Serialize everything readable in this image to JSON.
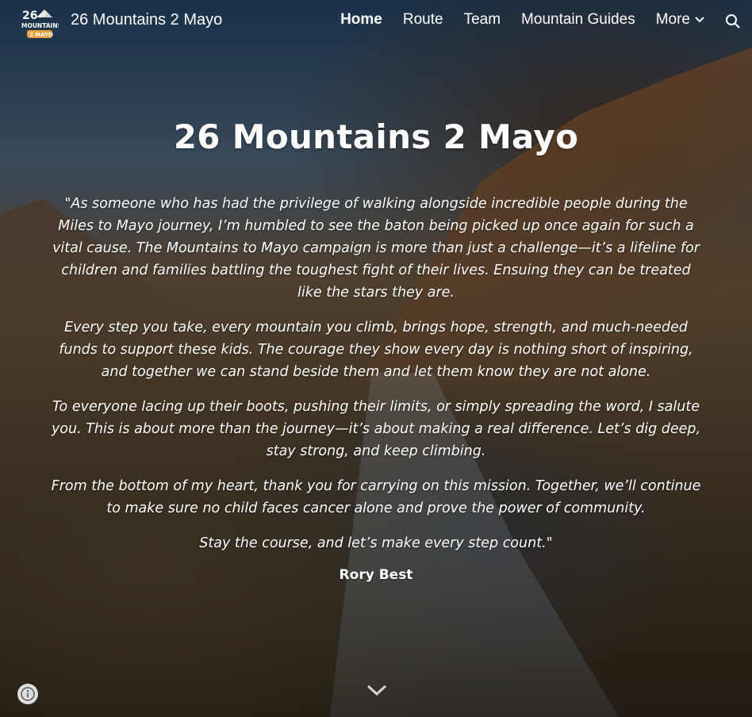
{
  "header": {
    "site_title": "26 Mountains 2 Mayo",
    "logo_text_top": "26",
    "logo_text_mid": "MOUNTAINS",
    "logo_text_bottom": "2 MAYO",
    "nav": [
      {
        "label": "Home",
        "active": true
      },
      {
        "label": "Route",
        "active": false
      },
      {
        "label": "Team",
        "active": false
      },
      {
        "label": "Mountain Guides",
        "active": false
      },
      {
        "label": "More",
        "active": false
      }
    ],
    "search_icon": "search-icon",
    "more_icon": "chevron-down-icon"
  },
  "main": {
    "title": "26 Mountains 2 Mayo",
    "quote_paragraphs": [
      "\"As someone who has had the privilege of walking alongside incredible people during the Miles to Mayo journey, I’m humbled to see the baton being picked up once again for such a vital cause. The Mountains to Mayo campaign is more than just a challenge—it’s a lifeline for children and families battling the toughest fight of their lives. Ensuing they can be treated like the stars they are.",
      "Every step you take, every mountain you climb, brings hope, strength, and much-needed funds to support these kids. The courage they show every day is nothing short of inspiring, and together we can stand beside them and let them know they are not alone.",
      "To everyone lacing up their boots, pushing their limits, or simply spreading the word, I salute you. This is about more than the journey—it’s about making a real difference. Let’s dig deep, stay strong, and keep climbing.",
      "From the bottom of my heart, thank you for carrying on this mission. Together, we’ll continue to make sure no child faces cancer alone and prove the power of community.",
      "Stay the course, and let’s make every step count.\""
    ],
    "author": "Rory Best"
  },
  "footer": {
    "info_icon": "info-icon",
    "scroll_icon": "scroll-down-icon"
  },
  "colors": {
    "logo_badge": "#e8a13a",
    "text": "#ffffff"
  }
}
